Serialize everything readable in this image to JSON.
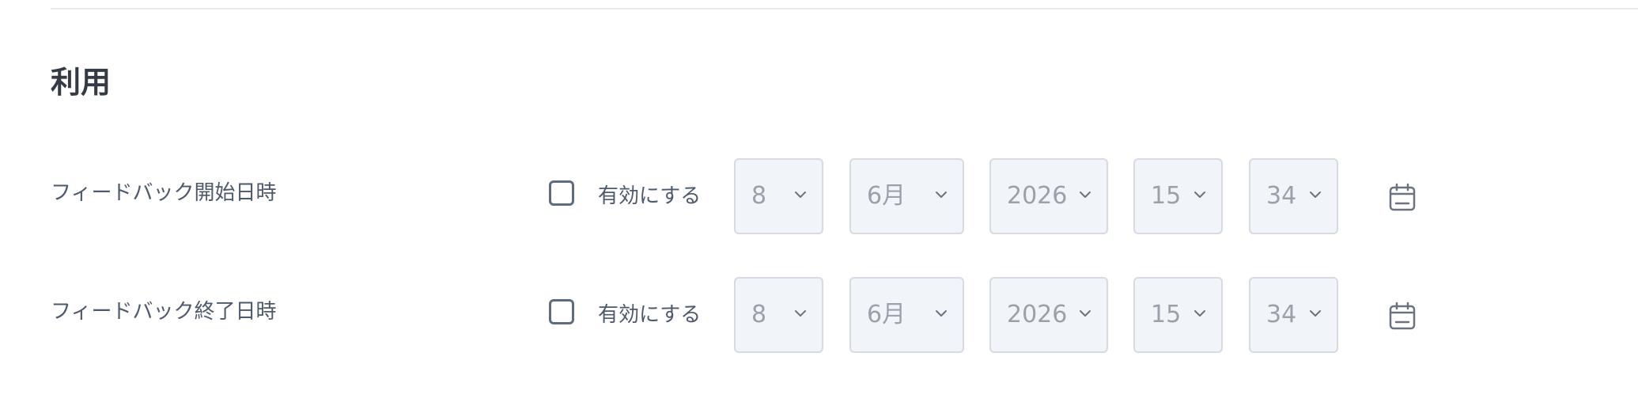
{
  "section": {
    "title": "利用"
  },
  "rows": [
    {
      "label": "フィードバック開始日時",
      "checkbox_label": "有効にする",
      "day": "8",
      "month": "6月",
      "year": "2026",
      "hour": "15",
      "minute": "34",
      "enabled": false
    },
    {
      "label": "フィードバック終了日時",
      "checkbox_label": "有効にする",
      "day": "8",
      "month": "6月",
      "year": "2026",
      "hour": "15",
      "minute": "34",
      "enabled": false
    }
  ],
  "icons": {
    "dropdown": "chevron-down-icon",
    "calendar": "calendar-icon"
  },
  "colors": {
    "title": "#343b45",
    "label": "#4d596c",
    "select_bg": "#f1f4f8",
    "select_border": "#d6dae2",
    "select_text": "#9ba1ab"
  }
}
